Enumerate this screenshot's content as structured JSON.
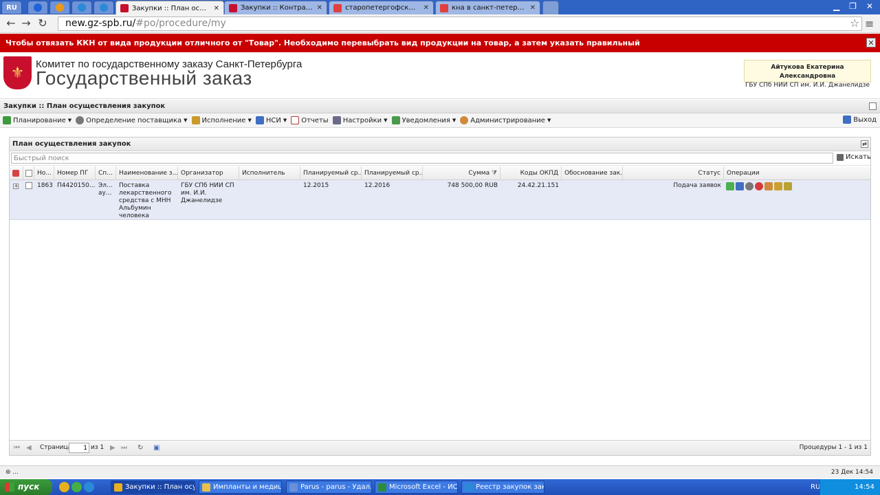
{
  "browser": {
    "app_label": "RU",
    "tabs": [
      {
        "title": "Закупки :: План осуществ",
        "active": true
      },
      {
        "title": "Закупки :: Контракты на зт"
      },
      {
        "title": "старопетергофский октмо"
      },
      {
        "title": "кна в санкт-петербурге оф"
      }
    ],
    "url_host": "new.gz-spb.ru/",
    "url_path": "#po/procedure/my"
  },
  "notice": {
    "text": "Чтобы отвязать ККН от вида продукции отличного от \"Товар\". Необходимо перевыбрать вид продукции на товар, а затем указать правильный"
  },
  "header": {
    "org_name": "Комитет по государственному заказу Санкт-Петербурга",
    "site_title": "Государственный заказ",
    "user_name": "Айтукова Екатерина Александровна",
    "user_org": "ГБУ СПб НИИ СП им. И.И. Джанелидзе"
  },
  "panel": {
    "title": "Закупки :: План осуществления закупок"
  },
  "toolbar": {
    "items": [
      {
        "label": "Планирование",
        "icon": "planning-icon",
        "color": "#3c9b3c",
        "dropdown": true
      },
      {
        "label": "Определение поставщика",
        "icon": "gears-icon",
        "color": "#777777",
        "dropdown": true
      },
      {
        "label": "Исполнение",
        "icon": "execution-icon",
        "color": "#c99a2c",
        "dropdown": true
      },
      {
        "label": "НСИ",
        "icon": "reference-icon",
        "color": "#3f6ec2",
        "dropdown": true
      },
      {
        "label": "Отчеты",
        "icon": "reports-icon",
        "color": "#b33b3b",
        "dropdown": false
      },
      {
        "label": "Настройки",
        "icon": "wrench-icon",
        "color": "#6a6a8a",
        "dropdown": true
      },
      {
        "label": "Уведомления",
        "icon": "notifications-icon",
        "color": "#4a9a4a",
        "dropdown": true
      },
      {
        "label": "Администрирование",
        "icon": "admin-icon",
        "color": "#d18a3a",
        "dropdown": true
      }
    ],
    "exit_label": "Выход"
  },
  "grid": {
    "title": "План осуществления закупок",
    "search_placeholder": "Быстрый поиск",
    "search_button": "Искать",
    "columns": {
      "num": "Но...",
      "pg_num": "Номер ПГ",
      "method": "Сп...",
      "name": "Наименование з...",
      "organizer": "Организатор",
      "executor": "Исполнитель",
      "plan_start": "Планируемый ср...",
      "plan_end": "Планируемый ср...",
      "sum": "Сумма",
      "okpd": "Коды ОКПД",
      "reason": "Обоснование зак...",
      "status": "Статус",
      "ops": "Операции"
    },
    "rows": [
      {
        "num": "1863",
        "pg_num": "П4420150...",
        "method": "Эл... ау...",
        "name": "Поставка лекарственного средства с МНН Альбумин человека",
        "organizer": "ГБУ СПб НИИ СП им. И.И. Джанелидзе",
        "executor": "",
        "plan_start": "12.2015",
        "plan_end": "12.2016",
        "sum": "748 500,00 RUB",
        "okpd": "24.42.21.151",
        "reason": "",
        "status": "Подача заявок"
      }
    ],
    "pager": {
      "page_label": "Страница",
      "page_value": "1",
      "of_label": "из 1",
      "info": "Процедуры 1 - 1 из 1"
    }
  },
  "statusbar": {
    "left": "...",
    "datetime": "23 Дек 14:54"
  },
  "taskbar": {
    "start_label": "пуск",
    "tasks": [
      {
        "label": "Закупки :: План осу...",
        "active": true
      },
      {
        "label": "Импланты и медици..."
      },
      {
        "label": "Parus - parus - Удал..."
      },
      {
        "label": "Microsoft Excel - ИСТ..."
      },
      {
        "label": "Реестр закупок зак..."
      }
    ],
    "lang": "RU",
    "clock": "14:54"
  }
}
